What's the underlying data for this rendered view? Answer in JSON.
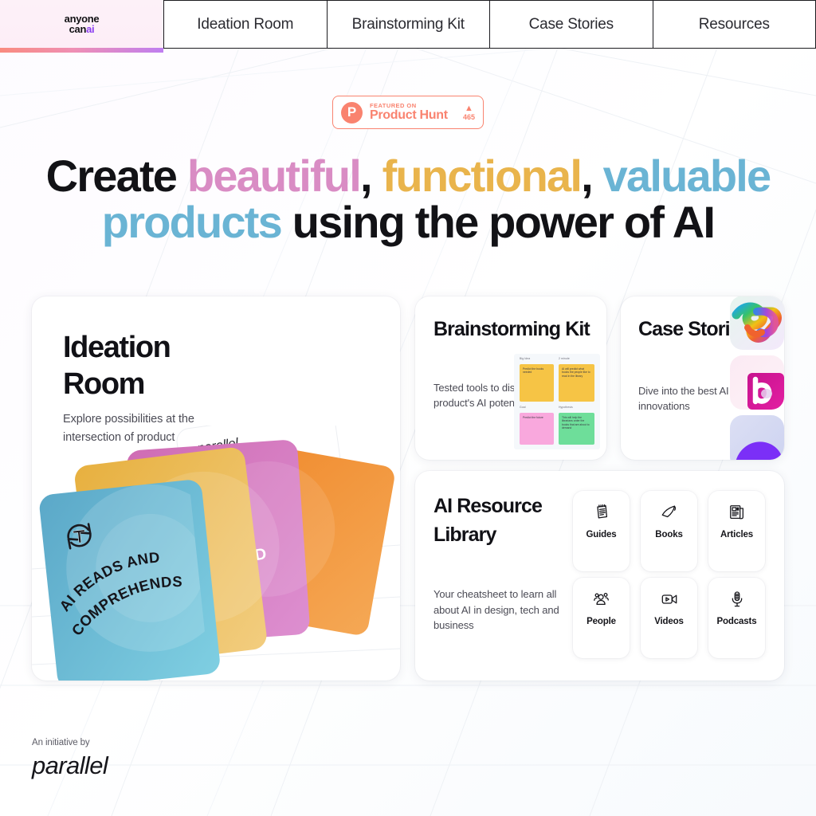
{
  "nav": {
    "logo": {
      "line1": "anyone",
      "line2_plain": "can",
      "line2_accent": "ai",
      "accent_color": "#8b3ff0"
    },
    "tabs": [
      {
        "label": "Ideation Room"
      },
      {
        "label": "Brainstorming Kit"
      },
      {
        "label": "Case Stories"
      },
      {
        "label": "Resources"
      }
    ]
  },
  "badge": {
    "logo_letter": "P",
    "featured_on": "FEATURED ON",
    "product": "Product Hunt",
    "arrow": "▲",
    "votes": "465",
    "color": "#f9836f"
  },
  "headline": {
    "part1": "Create ",
    "word_beautiful": "beautiful",
    "comma1": ", ",
    "word_functional": "functional",
    "comma2": ", ",
    "word_valuable": "valuable",
    "word_products": "products",
    "part_end": " using the power of AI",
    "colors": {
      "beautiful": "#d98cc4",
      "functional": "#e9b44c",
      "valuable": "#6ab4d4",
      "products": "#6ab4d4",
      "plain": "#121216"
    }
  },
  "cards": {
    "ideation": {
      "title": "Ideation Room",
      "description": "Explore possibilities at the intersection of product and AI",
      "art": {
        "deck_label": "parallel",
        "front_card_text": "AI READS AND COMPREHENDS",
        "back_card_text_fragment": "ND A",
        "front_icon": "text-refresh-icon"
      }
    },
    "brainstorming": {
      "title": "Brainstorming Kit",
      "description": "Tested tools to discover your product's AI potential",
      "stickies": [
        {
          "label": "Big Idea",
          "text": "Predict the books needed",
          "color": "#f6c445"
        },
        {
          "label": "2 minute",
          "text": "AI will predict what books the people like to read in the library",
          "color": "#f6c445"
        },
        {
          "label": "Goal",
          "text": "Predict the future",
          "color": "#f9a8dd"
        },
        {
          "label": "Hypothesis",
          "text": "This will help the librarians order the books that are about to demand",
          "color": "#6ede9a"
        }
      ]
    },
    "case_stories": {
      "title": "Case Stories",
      "description": "Dive into the best AI product innovations",
      "app_icons": [
        "copilot-icon",
        "bing-b-icon",
        "purple-wave-icon"
      ]
    },
    "library": {
      "title": "AI Resource Library",
      "description": "Your cheatsheet to learn all about AI in design, tech and business",
      "tiles": [
        {
          "label": "Guides",
          "icon": "notepad-icon"
        },
        {
          "label": "Books",
          "icon": "open-book-icon"
        },
        {
          "label": "Articles",
          "icon": "newspaper-icon"
        },
        {
          "label": "People",
          "icon": "people-group-icon"
        },
        {
          "label": "Videos",
          "icon": "video-camera-icon"
        },
        {
          "label": "Podcasts",
          "icon": "microphone-icon"
        }
      ]
    }
  },
  "footer": {
    "pretext": "An initiative by",
    "brand": "parallel"
  }
}
